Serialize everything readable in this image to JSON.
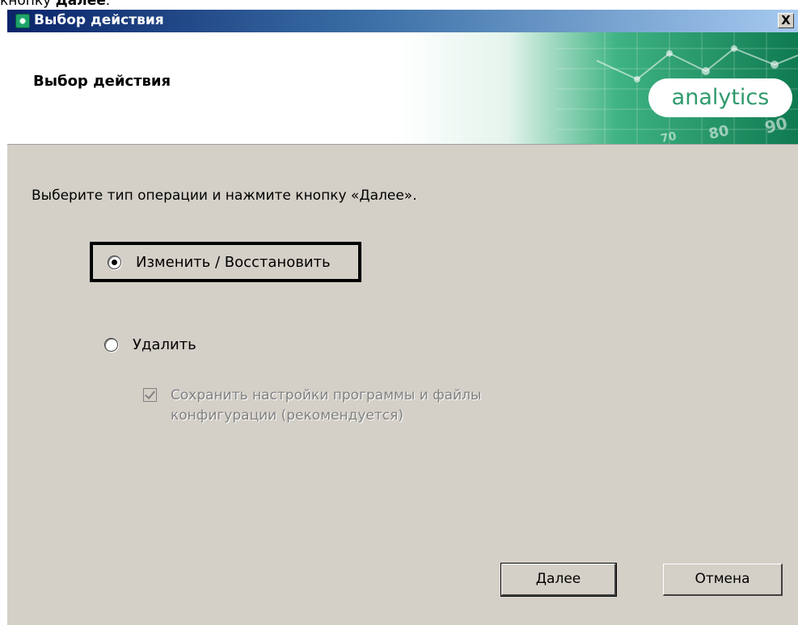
{
  "caption": {
    "prefix": "кнопку ",
    "bold": "Далее",
    "suffix": "."
  },
  "window": {
    "title": "Выбор действия",
    "close_label": "X"
  },
  "header": {
    "title": "Выбор действия",
    "logo_text": "analytics",
    "banner_numbers": [
      "80",
      "90",
      "70"
    ]
  },
  "instruction": "Выберите тип операции и нажмите кнопку «Далее».",
  "options": {
    "modify": {
      "label": "Изменить / Восстановить",
      "selected": true
    },
    "delete": {
      "label": "Удалить",
      "selected": false
    }
  },
  "keep_settings": {
    "line1": "Сохранить настройки программы и файлы",
    "line2": "конфигурации (рекомендуется)",
    "checked": true,
    "disabled": true
  },
  "buttons": {
    "next": "Далее",
    "cancel": "Отмена"
  },
  "colors": {
    "window_bg": "#d4d0c8",
    "title_start": "#0a246a",
    "title_end": "#a6caf0",
    "brand_green": "#2f9a6c"
  }
}
